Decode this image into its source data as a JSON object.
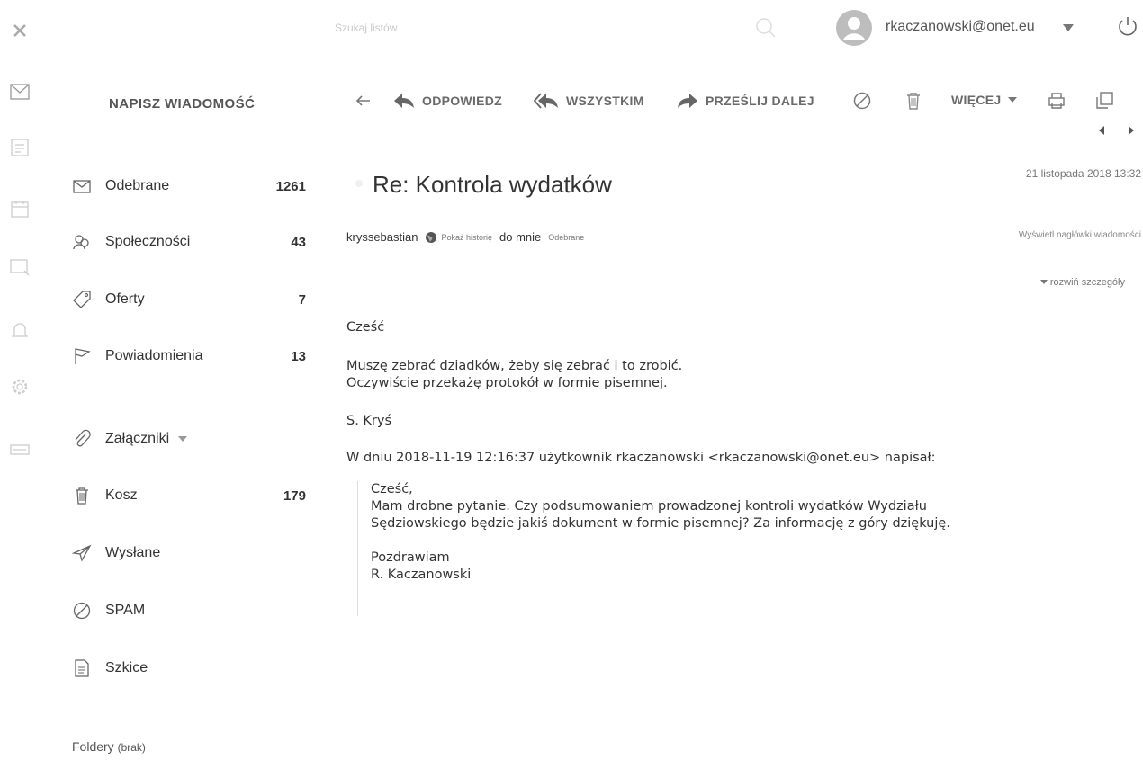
{
  "topbar": {
    "search_placeholder": "Szukaj listów",
    "account_email": "rkaczanowski@onet.eu"
  },
  "sidebar": {
    "compose_label": "NAPISZ WIADOMOŚĆ",
    "folders": [
      {
        "label": "Odebrane",
        "count": "1261",
        "icon": "envelope-icon"
      },
      {
        "label": "Społeczności",
        "count": "43",
        "icon": "people-icon"
      },
      {
        "label": "Oferty",
        "count": "7",
        "icon": "tag-icon"
      },
      {
        "label": "Powiadomienia",
        "count": "13",
        "icon": "flag-icon"
      },
      {
        "label": "Załączniki",
        "count": "",
        "icon": "paperclip-icon"
      },
      {
        "label": "Kosz",
        "count": "179",
        "icon": "trash-icon"
      },
      {
        "label": "Wysłane",
        "count": "",
        "icon": "send-icon"
      },
      {
        "label": "SPAM",
        "count": "",
        "icon": "block-icon"
      },
      {
        "label": "Szkice",
        "count": "",
        "icon": "draft-icon"
      }
    ],
    "folders_footer": "Foldery",
    "folders_footer_note": "(brak)"
  },
  "toolbar": {
    "reply_label": "ODPOWIEDZ",
    "reply_all_label": "WSZYSTKIM",
    "forward_label": "PRZEŚLIJ DALEJ",
    "more_label": "WIĘCEJ"
  },
  "message": {
    "subject": "Re: Kontrola wydatków",
    "date": "21 listopada 2018 13:32",
    "sender": "kryssebastian",
    "show_history": "Pokaż historię",
    "to": "do mnie",
    "folder_tag": "Odebrane",
    "headers_link": "Wyświetl nagłówki wiadomości",
    "details_link": "rozwiń szczegóły",
    "greeting": "Cześć",
    "line1": "Muszę zebrać dziadków, żeby się zebrać i to zrobić.",
    "line2": "Oczywiście przekażę protokół w formie pisemnej.",
    "signature": "S. Kryś",
    "quote_header": "W dniu 2018-11-19 12:16:37 użytkownik rkaczanowski <rkaczanowski@onet.eu> napisał:",
    "quote": {
      "greeting": "Cześć,",
      "line1": "Mam drobne pytanie. Czy podsumowaniem prowadzonej kontroli wydatków Wydziału",
      "line2": "Sędziowskiego będzie jakiś dokument w formie pisemnej? Za informację z góry dziękuję.",
      "closing": "Pozdrawiam",
      "name": "R. Kaczanowski"
    }
  }
}
